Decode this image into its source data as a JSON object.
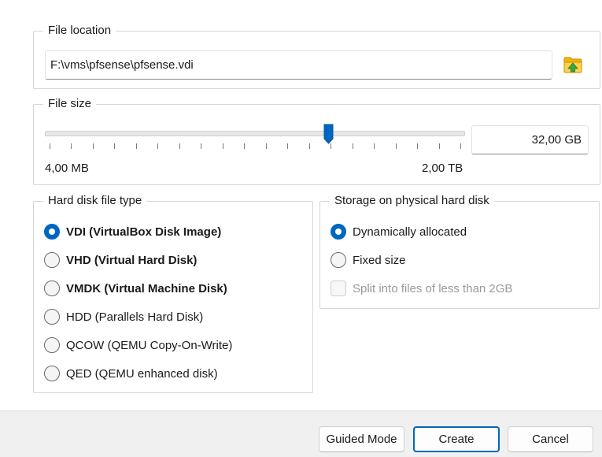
{
  "file_location": {
    "title": "File location",
    "path": "F:\\vms\\pfsense\\pfsense.vdi",
    "browse_icon": "folder-browse-icon"
  },
  "file_size": {
    "title": "File size",
    "value": "32,00 GB",
    "min_label": "4,00 MB",
    "max_label": "2,00 TB",
    "slider_position": 0.678,
    "tick_count": 20
  },
  "disk_type": {
    "title": "Hard disk file type",
    "options": [
      {
        "label": "VDI (VirtualBox Disk Image)",
        "checked": true,
        "bold": true
      },
      {
        "label": "VHD (Virtual Hard Disk)",
        "checked": false,
        "bold": true
      },
      {
        "label": "VMDK (Virtual Machine Disk)",
        "checked": false,
        "bold": true
      },
      {
        "label": "HDD (Parallels Hard Disk)",
        "checked": false,
        "bold": false
      },
      {
        "label": "QCOW (QEMU Copy-On-Write)",
        "checked": false,
        "bold": false
      },
      {
        "label": "QED (QEMU enhanced disk)",
        "checked": false,
        "bold": false
      }
    ]
  },
  "storage": {
    "title": "Storage on physical hard disk",
    "options": [
      {
        "label": "Dynamically allocated",
        "checked": true
      },
      {
        "label": "Fixed size",
        "checked": false
      }
    ],
    "split_checkbox": {
      "label": "Split into files of less than 2GB",
      "checked": false,
      "enabled": false
    }
  },
  "buttons": {
    "guided": "Guided Mode",
    "create": "Create",
    "cancel": "Cancel"
  },
  "colors": {
    "accent": "#0067c0",
    "bottom_bar": "#f0f0f0"
  }
}
